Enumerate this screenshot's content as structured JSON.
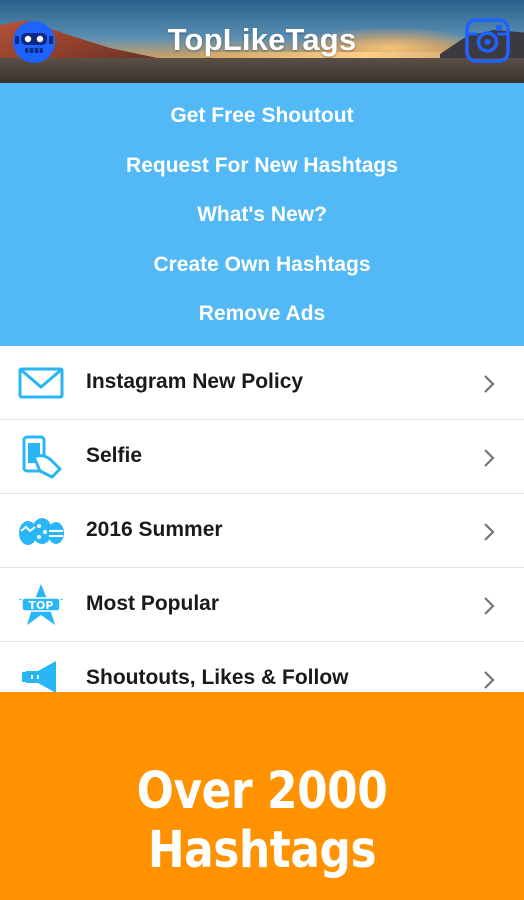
{
  "header": {
    "title": "TopLikeTags"
  },
  "menu": {
    "items": [
      {
        "label": "Get Free Shoutout"
      },
      {
        "label": "Request For New Hashtags"
      },
      {
        "label": "What's New?"
      },
      {
        "label": "Create Own Hashtags"
      },
      {
        "label": "Remove Ads"
      }
    ]
  },
  "categories": [
    {
      "label": "Instagram New Policy",
      "icon": "envelope-icon"
    },
    {
      "label": "Selfie",
      "icon": "selfie-phone-icon"
    },
    {
      "label": "2016 Summer",
      "icon": "easter-eggs-icon"
    },
    {
      "label": "Most Popular",
      "icon": "top-star-icon"
    },
    {
      "label": "Shoutouts, Likes & Follow",
      "icon": "megaphone-icon"
    }
  ],
  "banner": {
    "text": "Over 2000 Hashtags"
  },
  "colors": {
    "menu_bg": "#52b8f6",
    "icon_blue": "#29b6f6",
    "banner_bg": "#fe9200",
    "header_icon_blue": "#1e63ff"
  }
}
